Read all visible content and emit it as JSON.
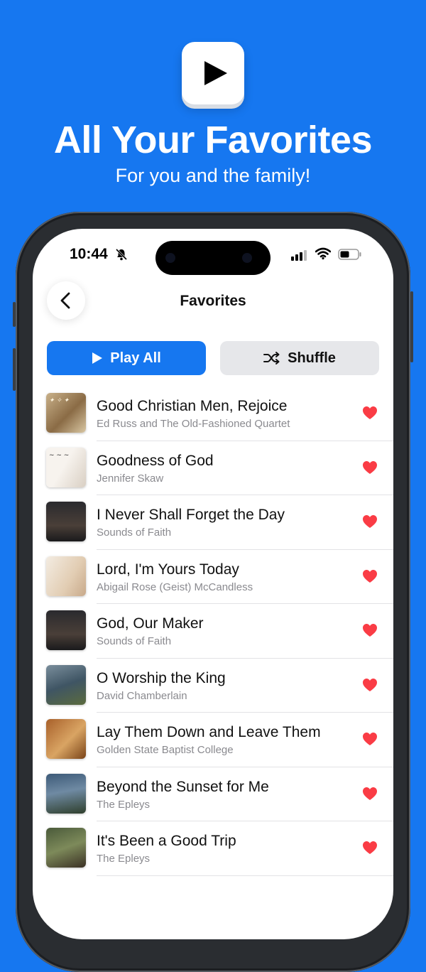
{
  "promo": {
    "headline": "All Your Favorites",
    "subline": "For you and the family!",
    "icon": "play-icon"
  },
  "status_bar": {
    "time": "10:44",
    "icons": [
      "bell-slash-icon",
      "signal-icon",
      "wifi-icon",
      "battery-icon"
    ]
  },
  "nav": {
    "title": "Favorites",
    "back_icon": "chevron-left-icon"
  },
  "actions": {
    "play_all_label": "Play All",
    "shuffle_label": "Shuffle"
  },
  "colors": {
    "brand_blue": "#1677f0",
    "heart_red": "#fa3c45",
    "secondary_text": "#8a8a8f"
  },
  "songs": [
    {
      "title": "Good Christian Men, Rejoice",
      "artist": "Ed Russ and The Old-Fashioned Quartet",
      "favorited": true
    },
    {
      "title": "Goodness of God",
      "artist": "Jennifer Skaw",
      "favorited": true
    },
    {
      "title": "I Never Shall Forget the Day",
      "artist": "Sounds of Faith",
      "favorited": true
    },
    {
      "title": "Lord, I'm Yours Today",
      "artist": "Abigail Rose (Geist) McCandless",
      "favorited": true
    },
    {
      "title": "God, Our Maker",
      "artist": "Sounds of Faith",
      "favorited": true
    },
    {
      "title": "O Worship the King",
      "artist": "David Chamberlain",
      "favorited": true
    },
    {
      "title": "Lay Them Down and Leave Them",
      "artist": "Golden State Baptist College",
      "favorited": true
    },
    {
      "title": "Beyond the Sunset for Me",
      "artist": "The Epleys",
      "favorited": true
    },
    {
      "title": "It's Been a Good Trip",
      "artist": "The Epleys",
      "favorited": true
    }
  ]
}
